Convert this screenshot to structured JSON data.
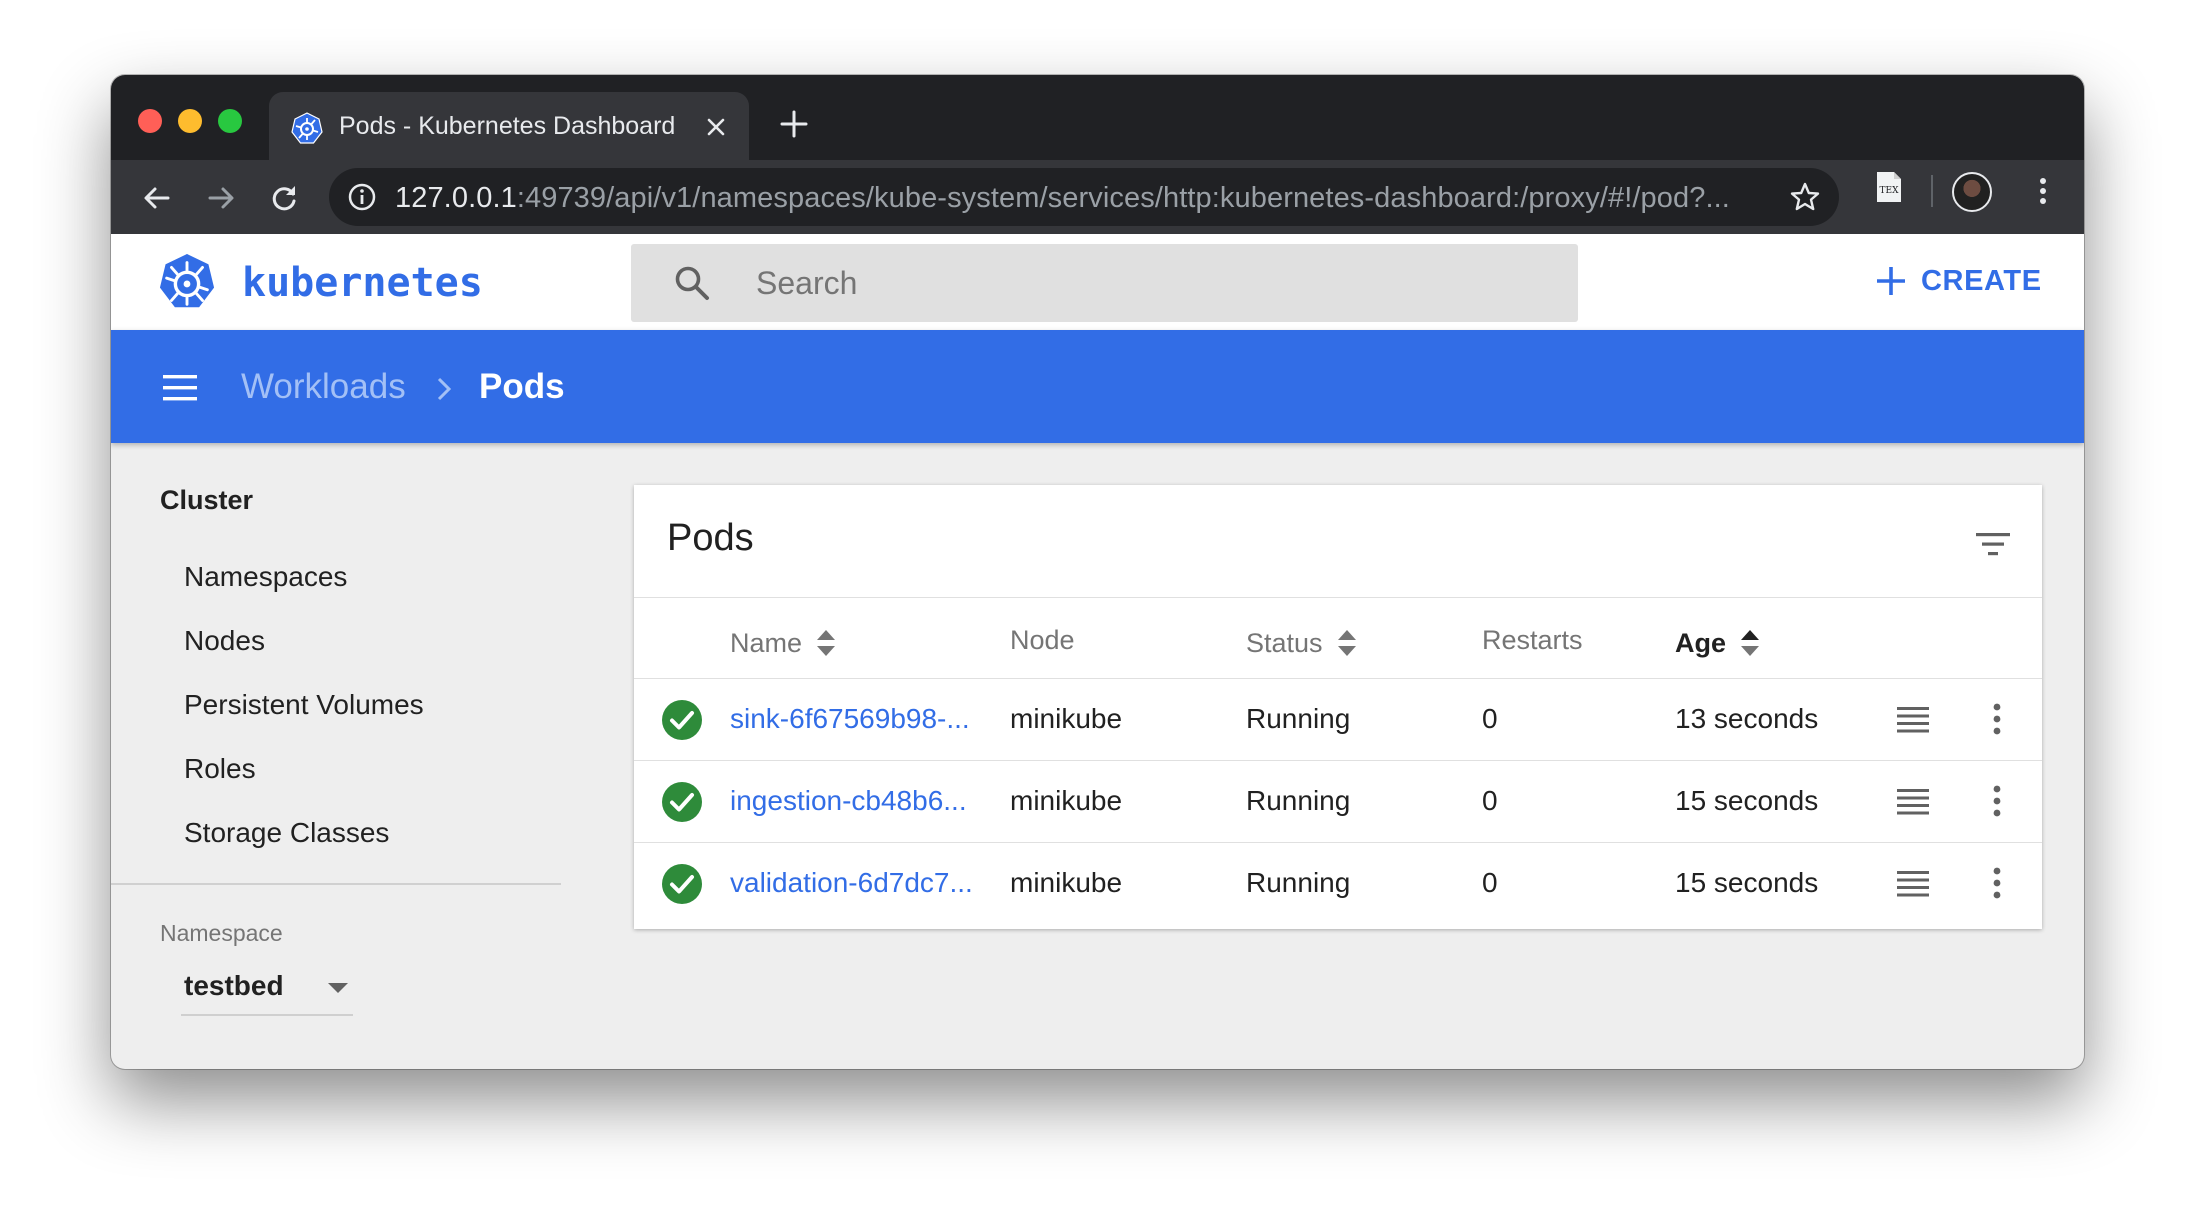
{
  "browser": {
    "tab_title": "Pods - Kubernetes Dashboard",
    "url_host": "127.0.0.1",
    "url_rest": ":49739/api/v1/namespaces/kube-system/services/http:kubernetes-dashboard:/proxy/#!/pod?...",
    "extension_label": "TEX"
  },
  "header": {
    "brand": "kubernetes",
    "search_placeholder": "Search",
    "create_label": "CREATE"
  },
  "breadcrumb": {
    "parent": "Workloads",
    "current": "Pods"
  },
  "sidebar": {
    "heading": "Cluster",
    "items": [
      "Namespaces",
      "Nodes",
      "Persistent Volumes",
      "Roles",
      "Storage Classes"
    ],
    "namespace_label": "Namespace",
    "namespace_value": "testbed"
  },
  "pods": {
    "title": "Pods",
    "columns": {
      "name": "Name",
      "node": "Node",
      "status": "Status",
      "restarts": "Restarts",
      "age": "Age"
    },
    "rows": [
      {
        "name": "sink-6f67569b98-...",
        "node": "minikube",
        "status": "Running",
        "restarts": "0",
        "age": "13 seconds"
      },
      {
        "name": "ingestion-cb48b6...",
        "node": "minikube",
        "status": "Running",
        "restarts": "0",
        "age": "15 seconds"
      },
      {
        "name": "validation-6d7dc7...",
        "node": "minikube",
        "status": "Running",
        "restarts": "0",
        "age": "15 seconds"
      }
    ]
  },
  "colors": {
    "brand_blue": "#326de6",
    "status_ok": "#2e8b3a",
    "chrome_dark": "#202124"
  }
}
